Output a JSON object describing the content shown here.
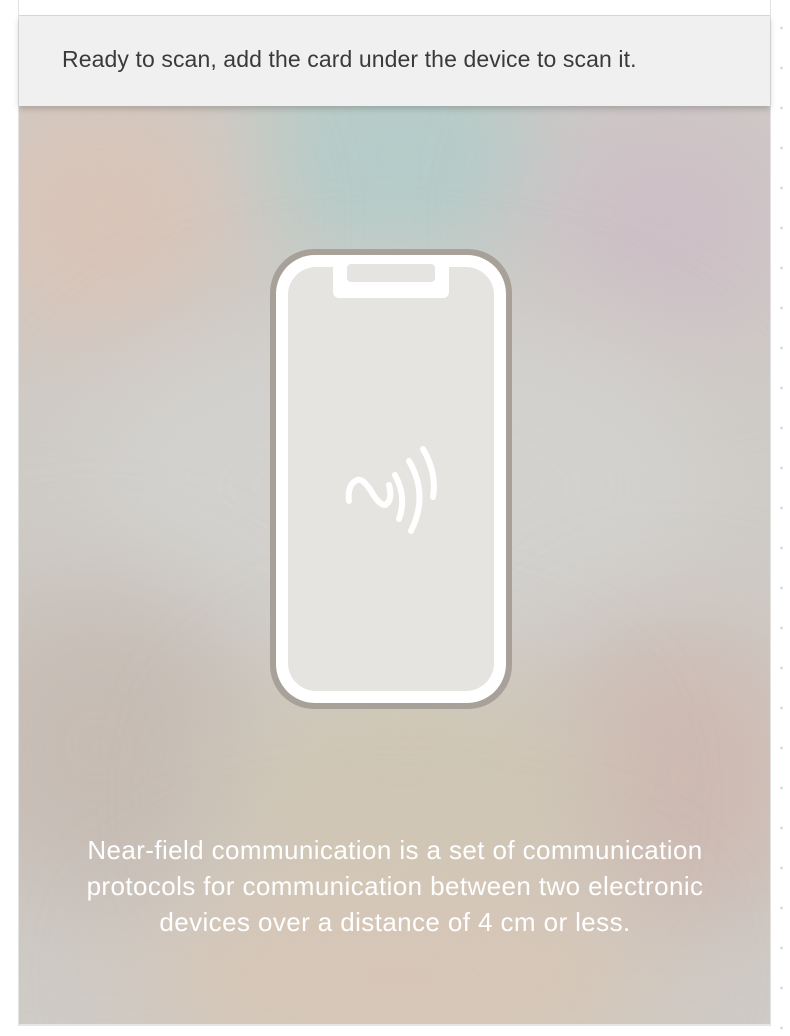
{
  "status": {
    "message": "Ready to scan, add the card under the device to scan it."
  },
  "illustration": {
    "device_icon": "smartphone-icon",
    "nfc_icon": "nfc-icon"
  },
  "description": {
    "text": "Near-field communication is a set of communication protocols for communication between two electronic devices over a distance of 4 cm or less."
  },
  "colors": {
    "status_background": "#f0f0f0",
    "status_text": "#3a3a3a",
    "phone_frame": "#a8a19a",
    "phone_screen": "#e6e4e0",
    "description_text": "#ffffff"
  }
}
